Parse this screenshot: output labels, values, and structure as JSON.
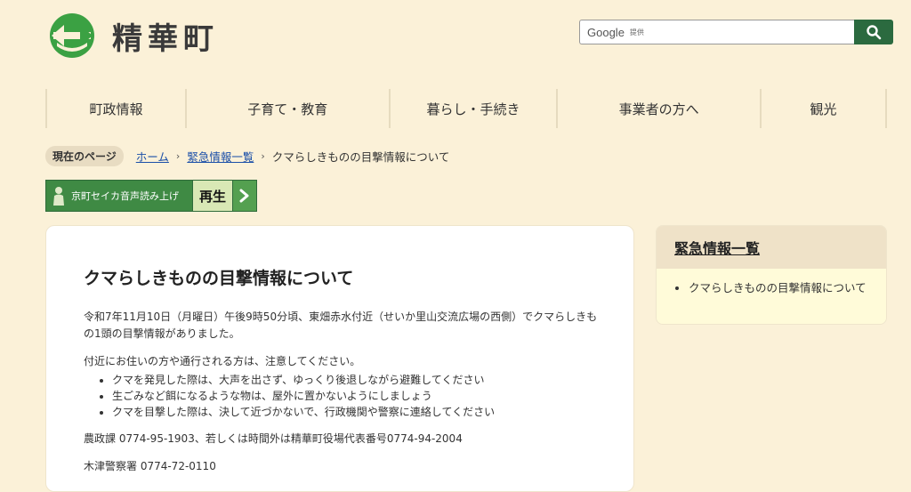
{
  "header": {
    "site_name": "精華町",
    "search": {
      "brand": "Google",
      "suffix": "提供",
      "placeholder": ""
    }
  },
  "nav": [
    {
      "label": "町政情報"
    },
    {
      "label": "子育て・教育"
    },
    {
      "label": "暮らし・手続き"
    },
    {
      "label": "事業者の方へ"
    },
    {
      "label": "観光"
    }
  ],
  "breadcrumb": {
    "label": "現在のページ",
    "links": [
      "ホーム",
      "緊急情報一覧"
    ],
    "current": "クマらしきものの目撃情報について"
  },
  "voice": {
    "label": "京町セイカ音声読み上げ",
    "play": "再生"
  },
  "article": {
    "title": "クマらしきものの目撃情報について",
    "para1": "令和7年11月10日（月曜日）午後9時50分頃、東畑赤水付近（せいか里山交流広場の西側）でクマらしきもの1頭の目撃情報がありました。",
    "para2": "付近にお住いの方や通行される方は、注意してください。",
    "bullets": [
      "クマを発見した際は、大声を出さず、ゆっくり後退しながら避難してください",
      "生ごみなど餌になるような物は、屋外に置かないようにしましょう",
      "クマを目撃した際は、決して近づかないで、行政機関や警察に連絡してください"
    ],
    "contact1": "農政課 0774-95-1903、若しくは時間外は精華町役場代表番号0774-94-2004",
    "contact2": "木津警察署 0774-72-0110"
  },
  "sidebar": {
    "title": "緊急情報一覧",
    "items": [
      "クマらしきものの目撃情報について"
    ]
  },
  "colors": {
    "background": "#fbf1d8",
    "brand_green": "#2b6a3f",
    "link": "#1a4ea8"
  }
}
